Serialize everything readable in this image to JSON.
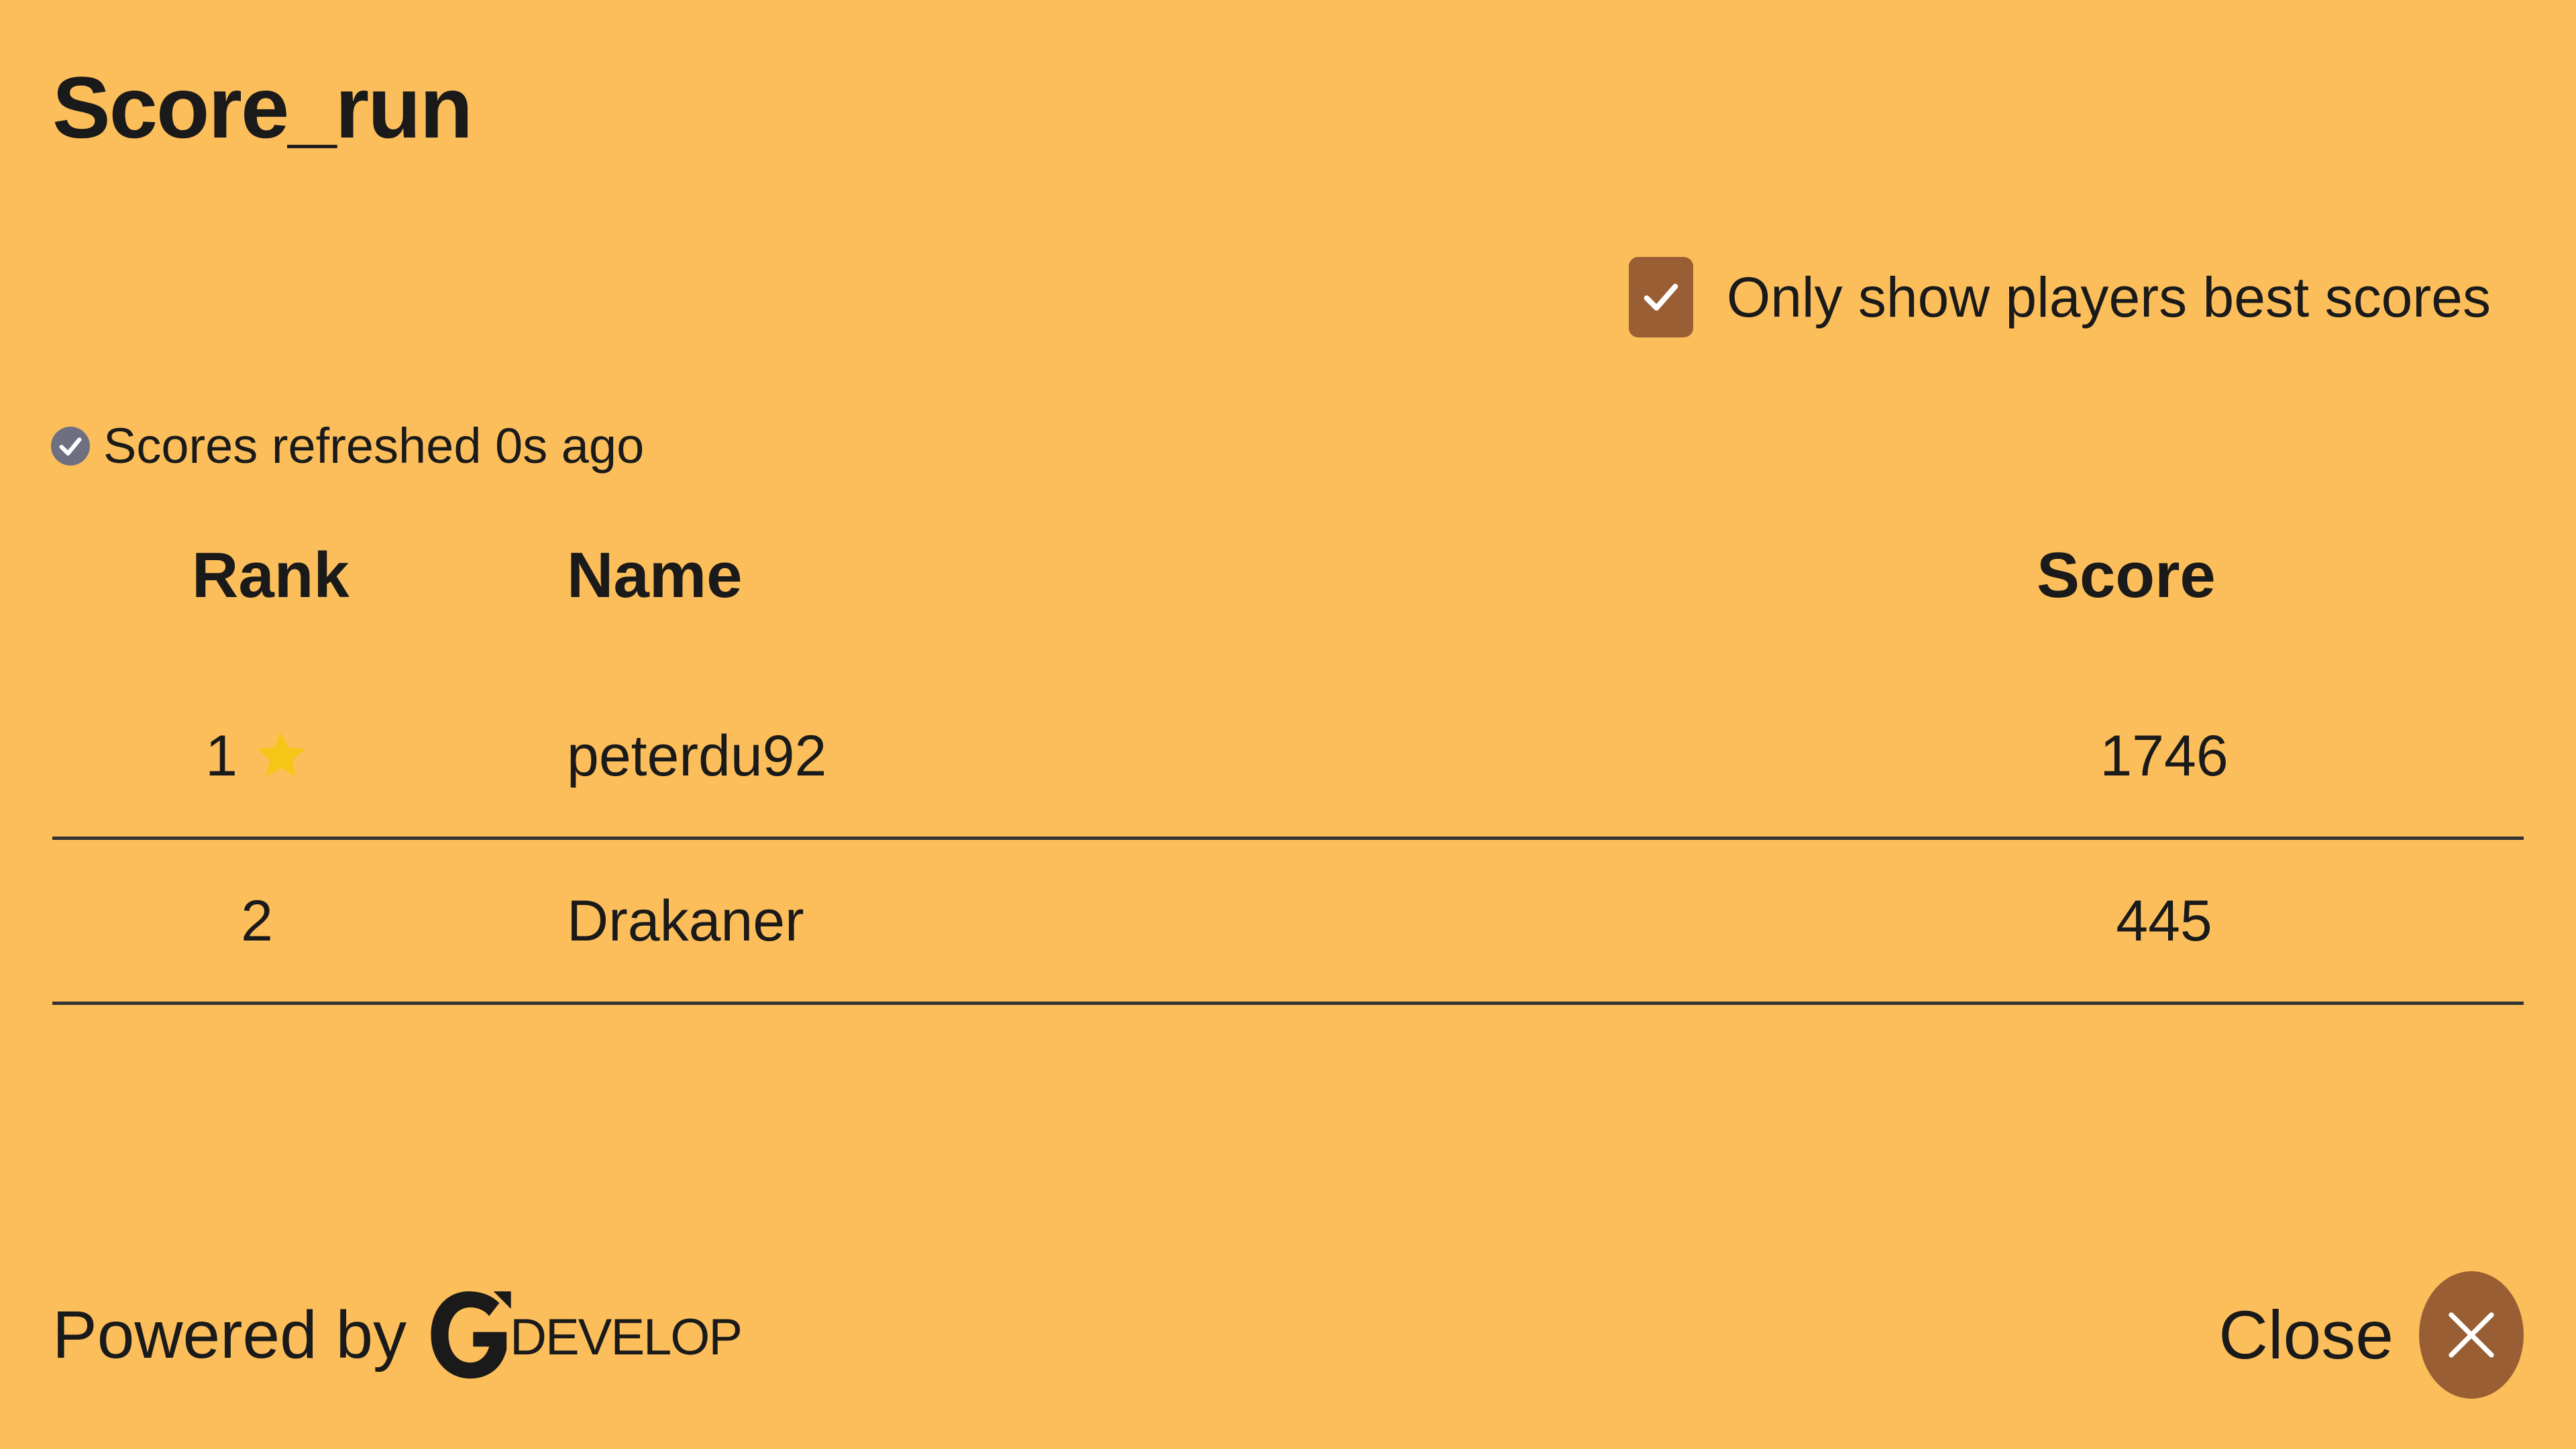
{
  "colors": {
    "background": "#FCBE5A",
    "accent": "#9A5E34",
    "star": "#F5C518",
    "refresh_icon": "#6F6F82",
    "text": "#1a1a1a"
  },
  "leaderboard": {
    "title": "Score_run"
  },
  "filter": {
    "label": "Only show players best scores",
    "checked": true
  },
  "status": {
    "refresh_text": "Scores refreshed 0s ago",
    "icon": "check-circle-icon"
  },
  "table": {
    "headers": {
      "rank": "Rank",
      "name": "Name",
      "score": "Score"
    },
    "rows": [
      {
        "rank": "1",
        "name": "peterdu92",
        "score": "1746",
        "starred": true
      },
      {
        "rank": "2",
        "name": "Drakaner",
        "score": "445",
        "starred": false
      }
    ]
  },
  "footer": {
    "powered_by": "Powered by",
    "brand_text": "DEVELOP",
    "close_label": "Close"
  }
}
